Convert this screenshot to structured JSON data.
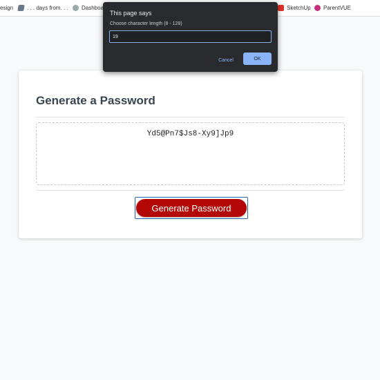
{
  "bookmarks": [
    {
      "label": "esign",
      "icon": ""
    },
    {
      "label": ". . . days from. . .",
      "icon": "stripes-icon"
    },
    {
      "label": "Dashboa",
      "icon": "globe-icon"
    },
    {
      "label": "SketchUp",
      "icon": "sketchup-icon"
    },
    {
      "label": "ParentVUE",
      "icon": "parentvue-icon"
    }
  ],
  "card": {
    "title": "Generate a Password",
    "password": "Yd5@Pn7$Js8-Xy9]Jp9",
    "generate_label": "Generate Password"
  },
  "dialog": {
    "title": "This page says",
    "message": "Choose character length (8 - 128)",
    "input_value": "19",
    "cancel_label": "Cancel",
    "ok_label": "OK"
  },
  "colors": {
    "page_bg": "#f8f9fc",
    "button_red": "#b40808",
    "dialog_bg": "#292a2d",
    "accent_blue": "#8ab4f8"
  }
}
